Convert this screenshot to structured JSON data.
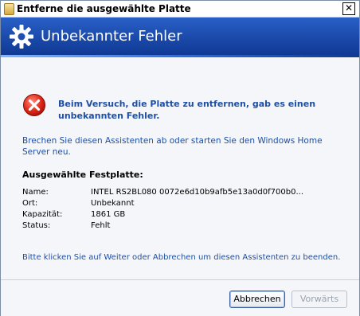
{
  "window": {
    "title": "Entferne die ausgewählte Platte",
    "close_glyph": "✕"
  },
  "header": {
    "title": "Unbekannter Fehler",
    "icon": "gear-icon"
  },
  "error": {
    "icon": "error-icon",
    "message": "Beim Versuch, die Platte zu entfernen, gab es einen unbekannten Fehler."
  },
  "info_text": "Brechen Sie diesen Assistenten ab oder starten Sie den Windows Home Server neu.",
  "selected_disk": {
    "heading": "Ausgewählte Festplatte:",
    "rows": [
      {
        "label": "Name:",
        "value": "INTEL  RS2BL080 0072e6d10b9afb5e13a0d0f700b0..."
      },
      {
        "label": "Ort:",
        "value": "Unbekannt"
      },
      {
        "label": "Kapazität:",
        "value": "1861 GB"
      },
      {
        "label": "Status:",
        "value": "Fehlt"
      }
    ]
  },
  "footer_text": "Bitte klicken Sie auf Weiter oder Abbrechen um diesen Assistenten zu beenden.",
  "buttons": {
    "cancel": "Abbrechen",
    "next": "Vorwärts"
  }
}
